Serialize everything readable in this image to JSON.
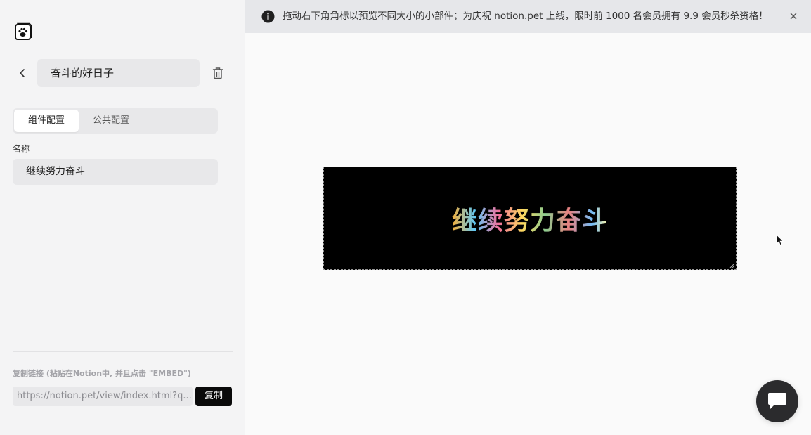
{
  "sidebar": {
    "widget_name": "奋斗的好日子",
    "tabs": [
      {
        "label": "组件配置",
        "active": true
      },
      {
        "label": "公共配置",
        "active": false
      }
    ],
    "name_field": {
      "label": "名称",
      "value": "继续努力奋斗"
    },
    "copy_link": {
      "label": "复制链接 (粘贴在Notion中, 并且点击 \"EMBED\")",
      "url": "https://notion.pet/view/index.html?q...",
      "button_label": "复制"
    }
  },
  "banner": {
    "text": "拖动右下角角标以预览不同大小的小部件；为庆祝 notion.pet 上线，限时前 1000 名会员拥有 9.9 会员秒杀资格！",
    "icon": "info-icon"
  },
  "preview": {
    "text": "继续努力奋斗",
    "background": "#000000"
  },
  "colors": {
    "sidebar_bg": "#f4f4f5",
    "accent": "#0a0a0a",
    "banner_bg": "#e6e7ea"
  }
}
